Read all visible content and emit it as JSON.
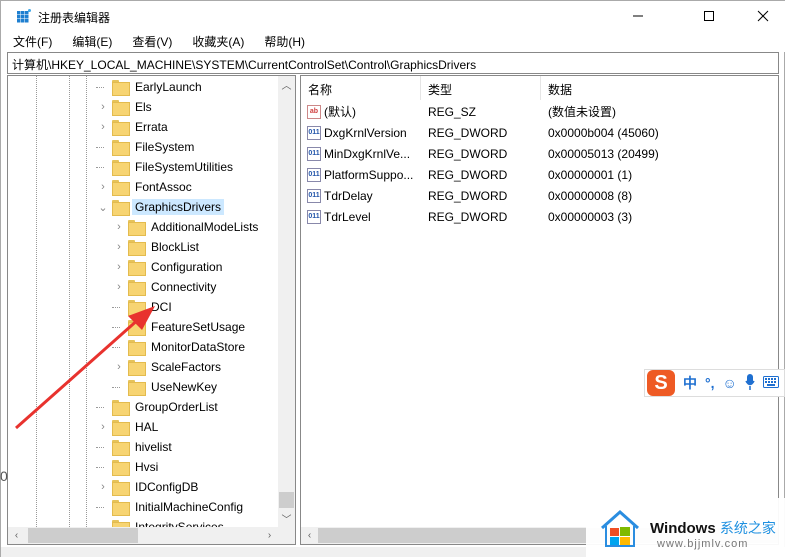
{
  "window": {
    "title": "注册表编辑器",
    "controls": {
      "minimize": "—",
      "maximize": "☐",
      "close": "✕"
    }
  },
  "menu": [
    "文件(F)",
    "编辑(E)",
    "查看(V)",
    "收藏夹(A)",
    "帮助(H)"
  ],
  "address": "计算机\\HKEY_LOCAL_MACHINE\\SYSTEM\\CurrentControlSet\\Control\\GraphicsDrivers",
  "tree": {
    "items": [
      {
        "label": "EarlyLaunch",
        "level": 0,
        "expander": "none"
      },
      {
        "label": "Els",
        "level": 0,
        "expander": "collapsed"
      },
      {
        "label": "Errata",
        "level": 0,
        "expander": "collapsed"
      },
      {
        "label": "FileSystem",
        "level": 0,
        "expander": "none"
      },
      {
        "label": "FileSystemUtilities",
        "level": 0,
        "expander": "none"
      },
      {
        "label": "FontAssoc",
        "level": 0,
        "expander": "collapsed"
      },
      {
        "label": "GraphicsDrivers",
        "level": 0,
        "expander": "expanded",
        "selected": true
      },
      {
        "label": "AdditionalModeLists",
        "level": 1,
        "expander": "collapsed"
      },
      {
        "label": "BlockList",
        "level": 1,
        "expander": "collapsed"
      },
      {
        "label": "Configuration",
        "level": 1,
        "expander": "collapsed"
      },
      {
        "label": "Connectivity",
        "level": 1,
        "expander": "collapsed"
      },
      {
        "label": "DCI",
        "level": 1,
        "expander": "none"
      },
      {
        "label": "FeatureSetUsage",
        "level": 1,
        "expander": "none"
      },
      {
        "label": "MonitorDataStore",
        "level": 1,
        "expander": "none"
      },
      {
        "label": "ScaleFactors",
        "level": 1,
        "expander": "collapsed"
      },
      {
        "label": "UseNewKey",
        "level": 1,
        "expander": "none"
      },
      {
        "label": "GroupOrderList",
        "level": 0,
        "expander": "none"
      },
      {
        "label": "HAL",
        "level": 0,
        "expander": "collapsed"
      },
      {
        "label": "hivelist",
        "level": 0,
        "expander": "none"
      },
      {
        "label": "Hvsi",
        "level": 0,
        "expander": "none"
      },
      {
        "label": "IDConfigDB",
        "level": 0,
        "expander": "collapsed"
      },
      {
        "label": "InitialMachineConfig",
        "level": 0,
        "expander": "none"
      },
      {
        "label": "IntegrityServices",
        "level": 0,
        "expander": "none"
      }
    ]
  },
  "list": {
    "columns": [
      "名称",
      "类型",
      "数据"
    ],
    "rows": [
      {
        "icon": "string-value-icon",
        "icon_text": "ab",
        "name": "(默认)",
        "type": "REG_SZ",
        "data": "(数值未设置)"
      },
      {
        "icon": "binary-value-icon",
        "icon_text": "011",
        "name": "DxgKrnlVersion",
        "type": "REG_DWORD",
        "data": "0x0000b004 (45060)"
      },
      {
        "icon": "binary-value-icon",
        "icon_text": "011",
        "name": "MinDxgKrnlVe...",
        "type": "REG_DWORD",
        "data": "0x00005013 (20499)"
      },
      {
        "icon": "binary-value-icon",
        "icon_text": "011",
        "name": "PlatformSuppo...",
        "type": "REG_DWORD",
        "data": "0x00000001 (1)"
      },
      {
        "icon": "binary-value-icon",
        "icon_text": "011",
        "name": "TdrDelay",
        "type": "REG_DWORD",
        "data": "0x00000008 (8)"
      },
      {
        "icon": "binary-value-icon",
        "icon_text": "011",
        "name": "TdrLevel",
        "type": "REG_DWORD",
        "data": "0x00000003 (3)"
      }
    ]
  },
  "ime": {
    "logo": "S",
    "mode": "中",
    "punct": "°,",
    "emoji": "☺",
    "mic": "🎤",
    "keyboard": "⌨"
  },
  "watermark": {
    "brand": "Windows",
    "brand_cn": "系统之家",
    "url": "www.bjjmlv.com"
  },
  "stray_text": "0",
  "colors": {
    "selection": "#cce8ff",
    "folder": "#f7d472",
    "annotation_arrow": "#e8322e",
    "ime_brand": "#ee5a24",
    "ime_accent": "#1e6fd0"
  }
}
